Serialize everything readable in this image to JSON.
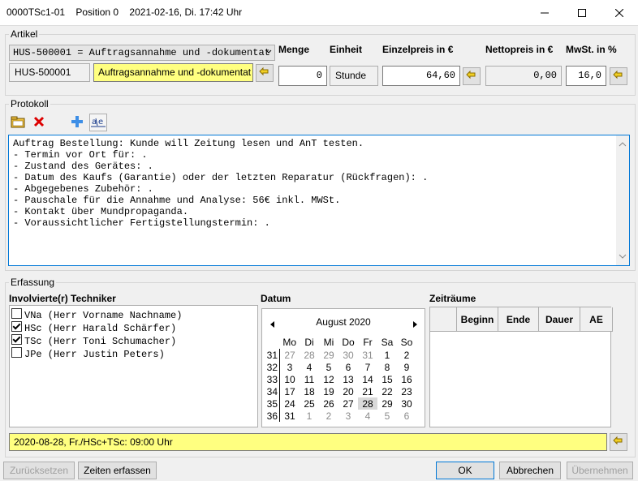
{
  "window": {
    "title": "0000TSc1-01    Position 0    2021-02-16, Di. 17:42 Uhr"
  },
  "artikel": {
    "group_label": "Artikel",
    "combo_value": "HUS-500001 = Auftragsannahme und -dokumentat",
    "code": "HUS-500001",
    "name": "Auftragsannahme und -dokumentat",
    "menge_label": "Menge",
    "menge_value": "0",
    "einheit_label": "Einheit",
    "einheit_value": "Stunde",
    "einzelpreis_label": "Einzelpreis in €",
    "einzelpreis_value": "64,60",
    "nettopreis_label": "Nettopreis in €",
    "nettopreis_value": "0,00",
    "mwst_label": "MwSt. in %",
    "mwst_value": "16,0"
  },
  "protokoll": {
    "group_label": "Protokoll",
    "lines": [
      "Auftrag Bestellung: Kunde will Zeitung lesen und AnT testen.",
      "- Termin vor Ort für: .",
      "- Zustand des Gerätes: .",
      "- Datum des Kaufs (Garantie) oder der letzten Reparatur (Rückfragen): .",
      "- Abgegebenes Zubehör: .",
      "- Pauschale für die Annahme und Analyse: 56€ inkl. MWSt.",
      "- Kontakt über Mundpropaganda.",
      "- Voraussichtlicher Fertigstellungstermin: ."
    ]
  },
  "erfassung": {
    "group_label": "Erfassung",
    "techniker_label": "Involvierte(r) Techniker",
    "techniker": [
      {
        "label": "VNa (Herr Vorname Nachname)",
        "checked": false
      },
      {
        "label": "HSc (Herr Harald Schärfer)",
        "checked": true
      },
      {
        "label": "TSc (Herr Toni Schumacher)",
        "checked": true
      },
      {
        "label": "JPe (Herr Justin Peters)",
        "checked": false
      }
    ],
    "datum_label": "Datum",
    "calendar": {
      "month": "August 2020",
      "weekdays": [
        "Mo",
        "Di",
        "Mi",
        "Do",
        "Fr",
        "Sa",
        "So"
      ],
      "weeks": [
        {
          "kw": "31",
          "days": [
            "27",
            "28",
            "29",
            "30",
            "31",
            "1",
            "2"
          ]
        },
        {
          "kw": "32",
          "days": [
            "3",
            "4",
            "5",
            "6",
            "7",
            "8",
            "9"
          ]
        },
        {
          "kw": "33",
          "days": [
            "10",
            "11",
            "12",
            "13",
            "14",
            "15",
            "16"
          ]
        },
        {
          "kw": "34",
          "days": [
            "17",
            "18",
            "19",
            "20",
            "21",
            "22",
            "23"
          ]
        },
        {
          "kw": "35",
          "days": [
            "24",
            "25",
            "26",
            "27",
            "28",
            "29",
            "30"
          ]
        },
        {
          "kw": "36",
          "days": [
            "31",
            "1",
            "2",
            "3",
            "4",
            "5",
            "6"
          ]
        }
      ]
    },
    "zeitraeume_label": "Zeiträume",
    "zeitraeume_columns": [
      "Beginn",
      "Ende",
      "Dauer",
      "AE"
    ],
    "summary": "2020-08-28, Fr./HSc+TSc: 09:00 Uhr"
  },
  "buttons": {
    "reset": "Zurücksetzen",
    "zeiten": "Zeiten erfassen",
    "ok": "OK",
    "abbrechen": "Abbrechen",
    "uebernehmen": "Übernehmen"
  },
  "colors": {
    "highlight": "#ffff80",
    "accent": "#0078d7"
  }
}
